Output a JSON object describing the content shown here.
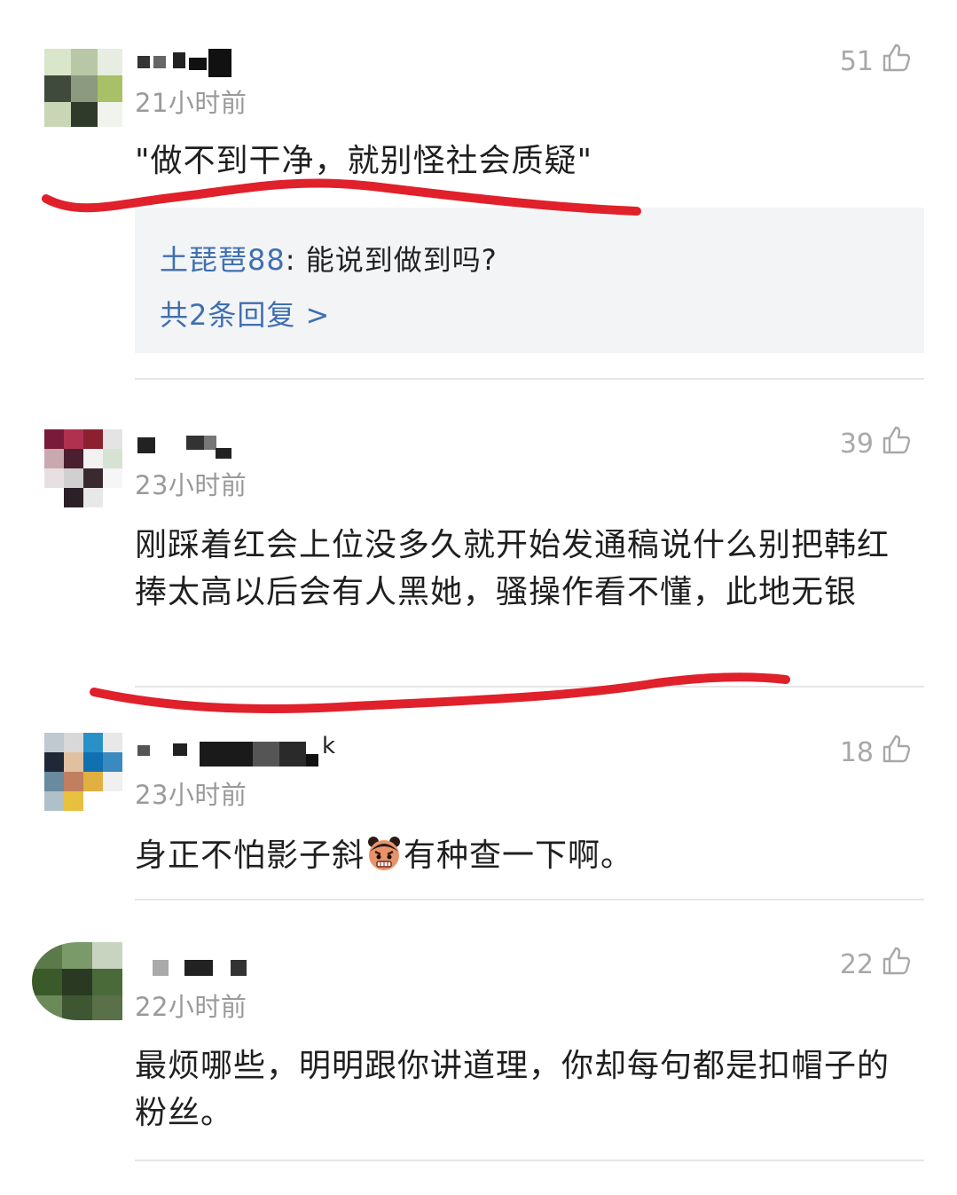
{
  "comments": [
    {
      "time": "21小时前",
      "likes": "51",
      "text": "\"做不到干净，就别怪社会质疑\"",
      "reply": {
        "user": "土琵琶88",
        "sep": ": ",
        "text": "能说到做到吗?",
        "more": "共2条回复 >"
      }
    },
    {
      "time": "23小时前",
      "likes": "39",
      "text": "刚踩着红会上位没多久就开始发通稿说什么别把韩红捧太高以后会有人黑她，骚操作看不懂，此地无银"
    },
    {
      "time": "23小时前",
      "likes": "18",
      "name_tail": "k",
      "text_before": "身正不怕影子斜",
      "emoji": "angry-face-emoji",
      "text_after": "有种查一下啊。"
    },
    {
      "time": "22小时前",
      "likes": "22",
      "text": "最烦哪些，明明跟你讲道理，你却每句都是扣帽子的粉丝。"
    }
  ],
  "icons": {
    "like": "thumbs-up-icon"
  },
  "colors": {
    "link": "#3f6fb0",
    "annotation": "#e0202a",
    "muted": "#9a9a9a"
  }
}
